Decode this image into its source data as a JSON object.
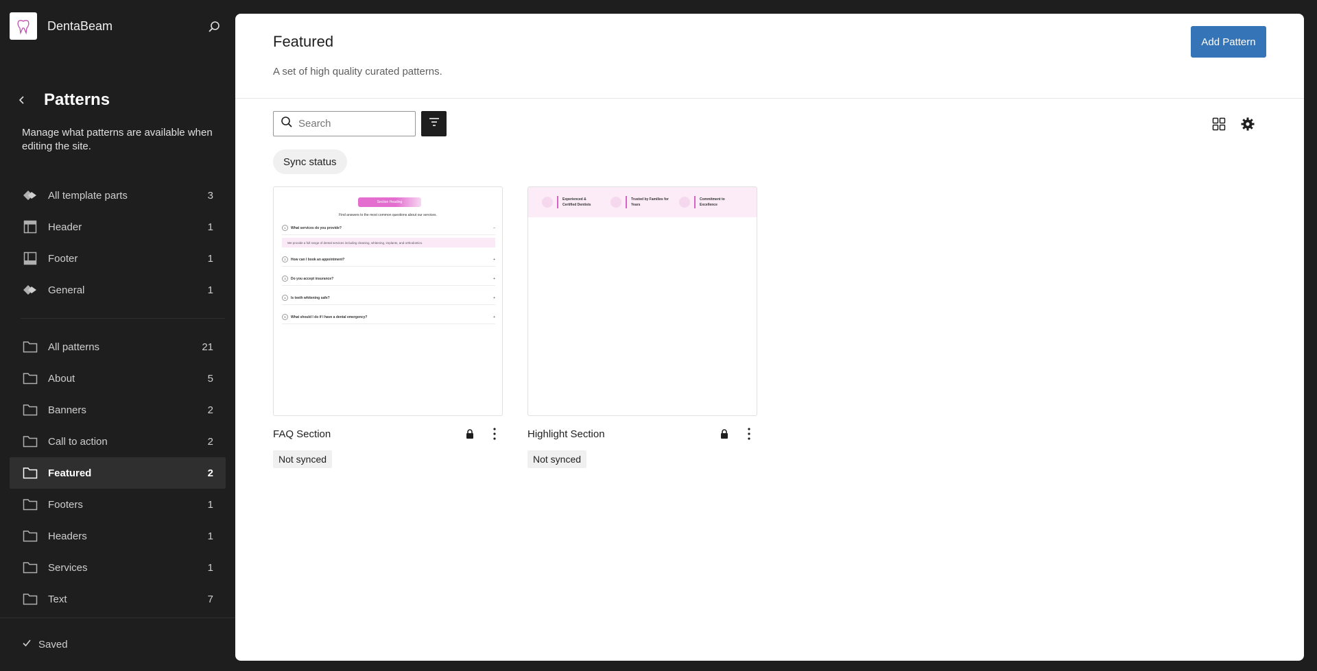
{
  "site": {
    "name": "DentaBeam"
  },
  "sidebar": {
    "title": "Patterns",
    "description": "Manage what patterns are available when editing the site.",
    "template_parts": [
      {
        "label": "All template parts",
        "count": "3",
        "icon": "symbol-icon"
      },
      {
        "label": "Header",
        "count": "1",
        "icon": "header-layout-icon"
      },
      {
        "label": "Footer",
        "count": "1",
        "icon": "footer-layout-icon"
      },
      {
        "label": "General",
        "count": "1",
        "icon": "symbol-icon"
      }
    ],
    "categories": [
      {
        "label": "All patterns",
        "count": "21"
      },
      {
        "label": "About",
        "count": "5"
      },
      {
        "label": "Banners",
        "count": "2"
      },
      {
        "label": "Call to action",
        "count": "2"
      },
      {
        "label": "Featured",
        "count": "2",
        "active": true
      },
      {
        "label": "Footers",
        "count": "1"
      },
      {
        "label": "Headers",
        "count": "1"
      },
      {
        "label": "Services",
        "count": "1"
      },
      {
        "label": "Text",
        "count": "7"
      }
    ],
    "saved_label": "Saved"
  },
  "main": {
    "title": "Featured",
    "description": "A set of high quality curated patterns.",
    "add_button": "Add Pattern",
    "search": {
      "placeholder": "Search",
      "value": ""
    },
    "filter_chip": "Sync status",
    "cards": [
      {
        "title": "FAQ Section",
        "badge": "Not synced",
        "preview": {
          "heading": "Section Heading",
          "subheading": "Find answers to the most common questions about our services.",
          "questions": [
            {
              "num": "1",
              "text": "What services do you provide?",
              "toggle": "–"
            },
            {
              "num": "2",
              "text": "How can I book an appointment?",
              "toggle": "+"
            },
            {
              "num": "3",
              "text": "Do you accept insurance?",
              "toggle": "+"
            },
            {
              "num": "4",
              "text": "Is teeth whitening safe?",
              "toggle": "+"
            },
            {
              "num": "5",
              "text": "What should I do if I have a dental emergency?",
              "toggle": "+"
            }
          ],
          "answer": "We provide a full range of dental services including cleaning, whitening, implants, and orthodontics."
        }
      },
      {
        "title": "Highlight Section",
        "badge": "Not synced",
        "preview": {
          "items": [
            "Experienced & Certified Dentists",
            "Trusted by Families for Years",
            "Commitment to Excellence"
          ]
        }
      }
    ]
  },
  "colors": {
    "sidebar_bg": "#1e1e1e",
    "accent": "#3574b7",
    "brand_pink": "#e36ed0"
  }
}
